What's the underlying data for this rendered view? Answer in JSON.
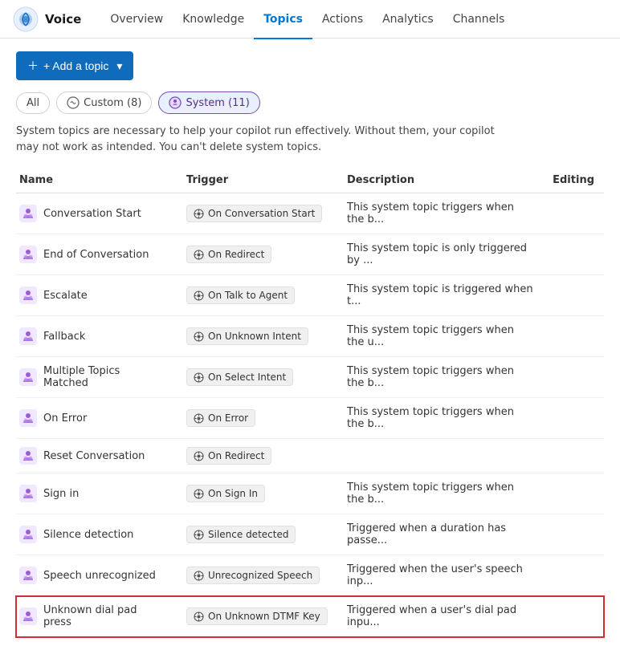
{
  "nav": {
    "brand": "Voice",
    "links": [
      {
        "label": "Overview",
        "active": false
      },
      {
        "label": "Knowledge",
        "active": false
      },
      {
        "label": "Topics",
        "active": true
      },
      {
        "label": "Actions",
        "active": false
      },
      {
        "label": "Analytics",
        "active": false
      },
      {
        "label": "Channels",
        "active": false
      }
    ]
  },
  "toolbar": {
    "add_topic_label": "+ Add a topic"
  },
  "filters": {
    "all_label": "All",
    "custom_label": "Custom (8)",
    "system_label": "System (11)"
  },
  "info_text": "System topics are necessary to help your copilot run effectively. Without them, your copilot may not work as intended. You can't delete system topics.",
  "table": {
    "columns": [
      "Name",
      "Trigger",
      "Description",
      "Editing"
    ],
    "rows": [
      {
        "name": "Conversation Start",
        "trigger": "On Conversation Start",
        "description": "This system topic triggers when the b...",
        "highlighted": false
      },
      {
        "name": "End of Conversation",
        "trigger": "On Redirect",
        "description": "This system topic is only triggered by ...",
        "highlighted": false
      },
      {
        "name": "Escalate",
        "trigger": "On Talk to Agent",
        "description": "This system topic is triggered when t...",
        "highlighted": false
      },
      {
        "name": "Fallback",
        "trigger": "On Unknown Intent",
        "description": "This system topic triggers when the u...",
        "highlighted": false
      },
      {
        "name": "Multiple Topics Matched",
        "trigger": "On Select Intent",
        "description": "This system topic triggers when the b...",
        "highlighted": false
      },
      {
        "name": "On Error",
        "trigger": "On Error",
        "description": "This system topic triggers when the b...",
        "highlighted": false
      },
      {
        "name": "Reset Conversation",
        "trigger": "On Redirect",
        "description": "",
        "highlighted": false
      },
      {
        "name": "Sign in",
        "trigger": "On Sign In",
        "description": "This system topic triggers when the b...",
        "highlighted": false
      },
      {
        "name": "Silence detection",
        "trigger": "Silence detected",
        "description": "Triggered when a duration has passe...",
        "highlighted": false
      },
      {
        "name": "Speech unrecognized",
        "trigger": "Unrecognized Speech",
        "description": "Triggered when the user's speech inp...",
        "highlighted": false
      },
      {
        "name": "Unknown dial pad press",
        "trigger": "On Unknown DTMF Key",
        "description": "Triggered when a user's dial pad inpu...",
        "highlighted": true
      }
    ]
  }
}
